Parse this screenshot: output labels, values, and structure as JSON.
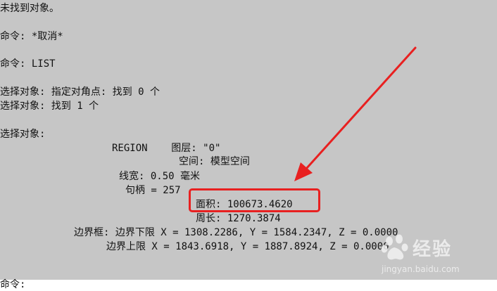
{
  "console": {
    "lines": [
      "未找到对象。",
      "命令: *取消*",
      "命令: LIST",
      "选择对象: 指定对角点: 找到 0 个",
      "选择对象: 找到 1 个",
      "选择对象:",
      "REGION    图层: \"0\"",
      "空间: 模型空间",
      "线宽: 0.50 毫米",
      "句柄 = 257",
      "面积: 100673.4620",
      "周长: 1270.3874",
      "边界框: 边界下限 X = 1308.2286, Y = 1584.2347, Z = 0.0000",
      "边界上限 X = 1843.6918, Y = 1887.8924, Z = 0.0000"
    ],
    "prompt": "命令:"
  },
  "annotation": {
    "highlight_color": "#e82020",
    "arrow_color": "#e82020"
  },
  "watermark": {
    "title": "经验",
    "url": "jingyan.baidu.com"
  }
}
